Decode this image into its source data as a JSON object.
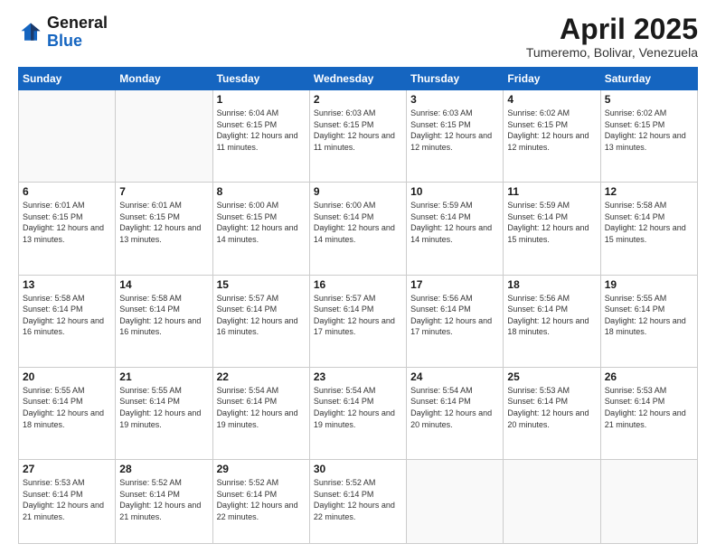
{
  "header": {
    "logo_general": "General",
    "logo_blue": "Blue",
    "month_title": "April 2025",
    "location": "Tumeremo, Bolivar, Venezuela"
  },
  "days_of_week": [
    "Sunday",
    "Monday",
    "Tuesday",
    "Wednesday",
    "Thursday",
    "Friday",
    "Saturday"
  ],
  "weeks": [
    [
      {
        "day": "",
        "info": ""
      },
      {
        "day": "",
        "info": ""
      },
      {
        "day": "1",
        "info": "Sunrise: 6:04 AM\nSunset: 6:15 PM\nDaylight: 12 hours and 11 minutes."
      },
      {
        "day": "2",
        "info": "Sunrise: 6:03 AM\nSunset: 6:15 PM\nDaylight: 12 hours and 11 minutes."
      },
      {
        "day": "3",
        "info": "Sunrise: 6:03 AM\nSunset: 6:15 PM\nDaylight: 12 hours and 12 minutes."
      },
      {
        "day": "4",
        "info": "Sunrise: 6:02 AM\nSunset: 6:15 PM\nDaylight: 12 hours and 12 minutes."
      },
      {
        "day": "5",
        "info": "Sunrise: 6:02 AM\nSunset: 6:15 PM\nDaylight: 12 hours and 13 minutes."
      }
    ],
    [
      {
        "day": "6",
        "info": "Sunrise: 6:01 AM\nSunset: 6:15 PM\nDaylight: 12 hours and 13 minutes."
      },
      {
        "day": "7",
        "info": "Sunrise: 6:01 AM\nSunset: 6:15 PM\nDaylight: 12 hours and 13 minutes."
      },
      {
        "day": "8",
        "info": "Sunrise: 6:00 AM\nSunset: 6:15 PM\nDaylight: 12 hours and 14 minutes."
      },
      {
        "day": "9",
        "info": "Sunrise: 6:00 AM\nSunset: 6:14 PM\nDaylight: 12 hours and 14 minutes."
      },
      {
        "day": "10",
        "info": "Sunrise: 5:59 AM\nSunset: 6:14 PM\nDaylight: 12 hours and 14 minutes."
      },
      {
        "day": "11",
        "info": "Sunrise: 5:59 AM\nSunset: 6:14 PM\nDaylight: 12 hours and 15 minutes."
      },
      {
        "day": "12",
        "info": "Sunrise: 5:58 AM\nSunset: 6:14 PM\nDaylight: 12 hours and 15 minutes."
      }
    ],
    [
      {
        "day": "13",
        "info": "Sunrise: 5:58 AM\nSunset: 6:14 PM\nDaylight: 12 hours and 16 minutes."
      },
      {
        "day": "14",
        "info": "Sunrise: 5:58 AM\nSunset: 6:14 PM\nDaylight: 12 hours and 16 minutes."
      },
      {
        "day": "15",
        "info": "Sunrise: 5:57 AM\nSunset: 6:14 PM\nDaylight: 12 hours and 16 minutes."
      },
      {
        "day": "16",
        "info": "Sunrise: 5:57 AM\nSunset: 6:14 PM\nDaylight: 12 hours and 17 minutes."
      },
      {
        "day": "17",
        "info": "Sunrise: 5:56 AM\nSunset: 6:14 PM\nDaylight: 12 hours and 17 minutes."
      },
      {
        "day": "18",
        "info": "Sunrise: 5:56 AM\nSunset: 6:14 PM\nDaylight: 12 hours and 18 minutes."
      },
      {
        "day": "19",
        "info": "Sunrise: 5:55 AM\nSunset: 6:14 PM\nDaylight: 12 hours and 18 minutes."
      }
    ],
    [
      {
        "day": "20",
        "info": "Sunrise: 5:55 AM\nSunset: 6:14 PM\nDaylight: 12 hours and 18 minutes."
      },
      {
        "day": "21",
        "info": "Sunrise: 5:55 AM\nSunset: 6:14 PM\nDaylight: 12 hours and 19 minutes."
      },
      {
        "day": "22",
        "info": "Sunrise: 5:54 AM\nSunset: 6:14 PM\nDaylight: 12 hours and 19 minutes."
      },
      {
        "day": "23",
        "info": "Sunrise: 5:54 AM\nSunset: 6:14 PM\nDaylight: 12 hours and 19 minutes."
      },
      {
        "day": "24",
        "info": "Sunrise: 5:54 AM\nSunset: 6:14 PM\nDaylight: 12 hours and 20 minutes."
      },
      {
        "day": "25",
        "info": "Sunrise: 5:53 AM\nSunset: 6:14 PM\nDaylight: 12 hours and 20 minutes."
      },
      {
        "day": "26",
        "info": "Sunrise: 5:53 AM\nSunset: 6:14 PM\nDaylight: 12 hours and 21 minutes."
      }
    ],
    [
      {
        "day": "27",
        "info": "Sunrise: 5:53 AM\nSunset: 6:14 PM\nDaylight: 12 hours and 21 minutes."
      },
      {
        "day": "28",
        "info": "Sunrise: 5:52 AM\nSunset: 6:14 PM\nDaylight: 12 hours and 21 minutes."
      },
      {
        "day": "29",
        "info": "Sunrise: 5:52 AM\nSunset: 6:14 PM\nDaylight: 12 hours and 22 minutes."
      },
      {
        "day": "30",
        "info": "Sunrise: 5:52 AM\nSunset: 6:14 PM\nDaylight: 12 hours and 22 minutes."
      },
      {
        "day": "",
        "info": ""
      },
      {
        "day": "",
        "info": ""
      },
      {
        "day": "",
        "info": ""
      }
    ]
  ]
}
